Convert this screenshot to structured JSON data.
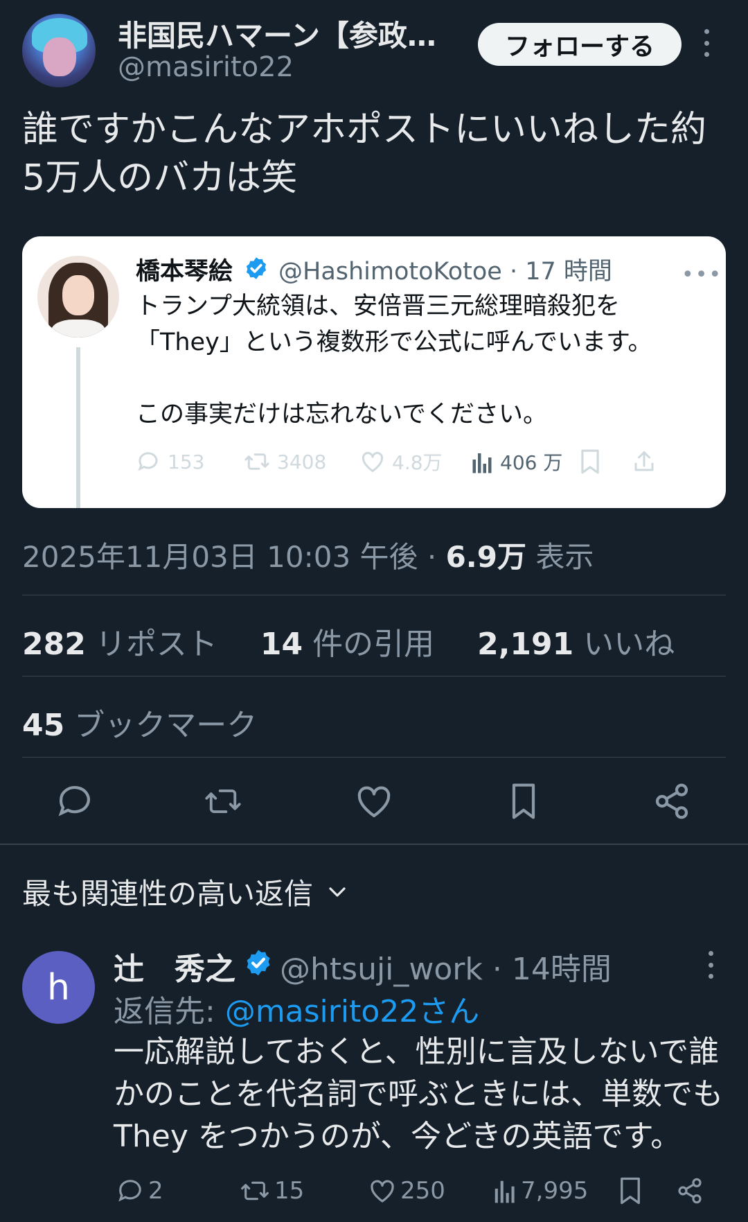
{
  "author": {
    "display_name": "非国民ハマーン【参政…",
    "handle": "@masirito22",
    "follow_label": "フォローする"
  },
  "tweet": {
    "lines": [
      "誰ですかこんなアホポストにいいねした約",
      "5万人のバカは笑"
    ],
    "timestamp": "2025年11月03日 10:03 午後 · ",
    "views_count": "6.9万",
    "views_label": " 表示"
  },
  "quote": {
    "name": "橋本琴絵",
    "handle_time": "@HashimotoKotoe · 17 時間",
    "lines": [
      "トランプ大統領は、安倍晋三元総理暗殺犯を",
      "「They」という複数形で公式に呼んでいます。",
      "",
      "この事実だけは忘れないでください。"
    ],
    "replies": "153",
    "reposts": "3408",
    "likes": "4.8万",
    "views": "406 万"
  },
  "stats": {
    "reposts_count": "282",
    "reposts_label": " リポスト",
    "quotes_count": "14",
    "quotes_label": " 件の引用",
    "likes_count": "2,191",
    "likes_label": " いいね",
    "bookmarks_count": "45",
    "bookmarks_label": " ブックマーク"
  },
  "replies_header": "最も関連性の高い返信",
  "reply": {
    "avatar_letter": "h",
    "name": "辻　秀之",
    "handle_time": "@htsuji_work · 14時間",
    "reply_to_prefix": "返信先: ",
    "reply_to_handle": "@masirito22さん",
    "lines": [
      "一応解説しておくと、性別に言及しないで誰",
      "かのことを代名詞で呼ぶときには、単数でも",
      "They をつかうのが、今どきの英語です。"
    ],
    "replies": "2",
    "reposts": "15",
    "likes": "250",
    "views": "7,995"
  },
  "colors": {
    "background": "#15202b",
    "accent": "#1d9bf0",
    "text": "#e7e9ea",
    "muted": "#8b98a5"
  }
}
